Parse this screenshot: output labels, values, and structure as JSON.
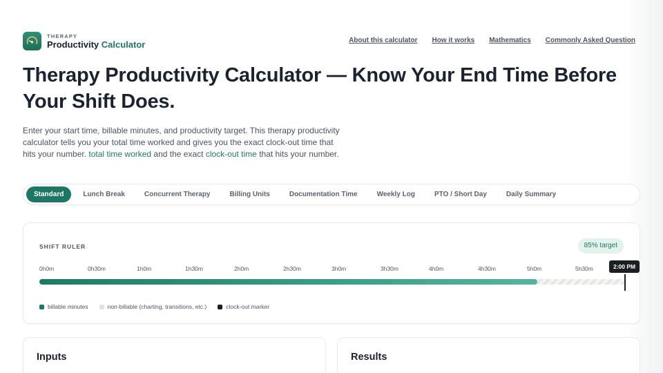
{
  "brand": {
    "top": "THERAPY",
    "main": "Productivity",
    "accent": "Calculator",
    "logo_icon": "gauge-icon",
    "accent_color": "#1e7763"
  },
  "nav": {
    "items": [
      "About this calculator",
      "How it works",
      "Mathematics",
      "Commonly Asked Question"
    ]
  },
  "hero": {
    "title": "Therapy Productivity Calculator — Know Your End Time Before Your Shift Does.",
    "text_part1": "Enter your start time, billable minutes, and productivity target. This therapy productivity calculator tells you your total time worked and gives you the exact clock-out time that hits your number. ",
    "link1": "total time worked",
    "text_part2": " and the exact ",
    "link2": "clock-out time",
    "text_part3": " that hits your number."
  },
  "tabs": {
    "items": [
      "Standard",
      "Lunch Break",
      "Concurrent Therapy",
      "Billing Units",
      "Documentation Time",
      "Weekly Log",
      "PTO / Short Day",
      "Daily Summary"
    ],
    "active_index": 0
  },
  "ruler": {
    "label": "SHIFT RULER",
    "target": "85% target",
    "ticks": [
      "0h0m",
      "0h30m",
      "1h0m",
      "1h30m",
      "2h0m",
      "2h30m",
      "3h0m",
      "3h30m",
      "4h0m",
      "4h30m",
      "5h0m",
      "5h30m"
    ],
    "billable_fraction": 0.85,
    "marker_label": "2:00 PM",
    "legend": {
      "billable": "billable minutes",
      "nonbillable": "non-billable (charting, transitions, etc.)",
      "clockout": "clock-out marker"
    },
    "colors": {
      "billable": "#1e7763",
      "nonbillable": "#e2e2df",
      "marker": "#1b1f24"
    }
  },
  "panels": {
    "inputs_title": "Inputs",
    "results_title": "Results"
  }
}
